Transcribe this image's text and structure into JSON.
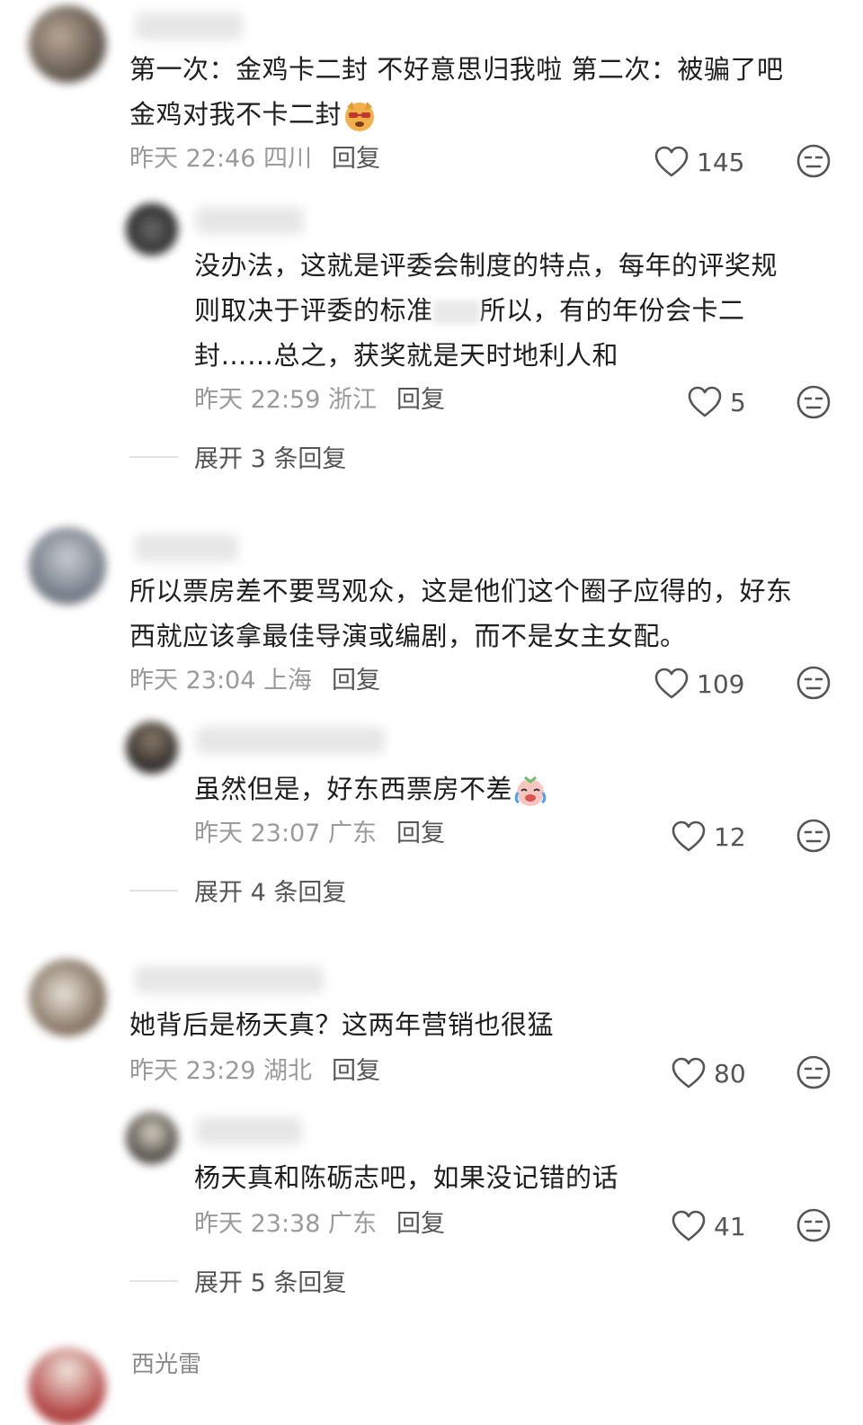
{
  "comments": [
    {
      "text_line1": "第一次：金鸡卡二封 不好意思归我啦 第二次：被骗了吧",
      "text_line2": "金鸡对我不卡二封",
      "time": "昨天 22:46 四川",
      "reply": "回复",
      "likes": "145",
      "sub": {
        "text_line1": "没办法，这就是评委会制度的特点，每年的评奖规",
        "text_line2a": "则取决于评委的标准",
        "text_line2b": "所以，有的年份会卡二",
        "text_line3": "封……总之，获奖就是天时地利人和",
        "time": "昨天 22:59 浙江",
        "reply": "回复",
        "likes": "5"
      },
      "expand": "展开 3 条回复"
    },
    {
      "text_line1": "所以票房差不要骂观众，这是他们这个圈子应得的，好东",
      "text_line2": "西就应该拿最佳导演或编剧，而不是女主女配。",
      "time": "昨天 23:04 上海",
      "reply": "回复",
      "likes": "109",
      "sub": {
        "text_line1": "虽然但是，好东西票房不差",
        "time": "昨天 23:07 广东",
        "reply": "回复",
        "likes": "12"
      },
      "expand": "展开 4 条回复"
    },
    {
      "text_line1": "她背后是杨天真？这两年营销也很猛",
      "time": "昨天 23:29 湖北",
      "reply": "回复",
      "likes": "80",
      "sub": {
        "text_line1": "杨天真和陈砺志吧，如果没记错的话",
        "time": "昨天 23:38 广东",
        "reply": "回复",
        "likes": "41"
      },
      "expand": "展开 5 条回复"
    }
  ],
  "partial_username": "西光雷",
  "icons": {
    "like": "heart-outline-icon",
    "dislike": "neutral-face-icon",
    "emoji1": "cool-dog-emoji",
    "emoji2": "crying-laughing-emoji"
  }
}
